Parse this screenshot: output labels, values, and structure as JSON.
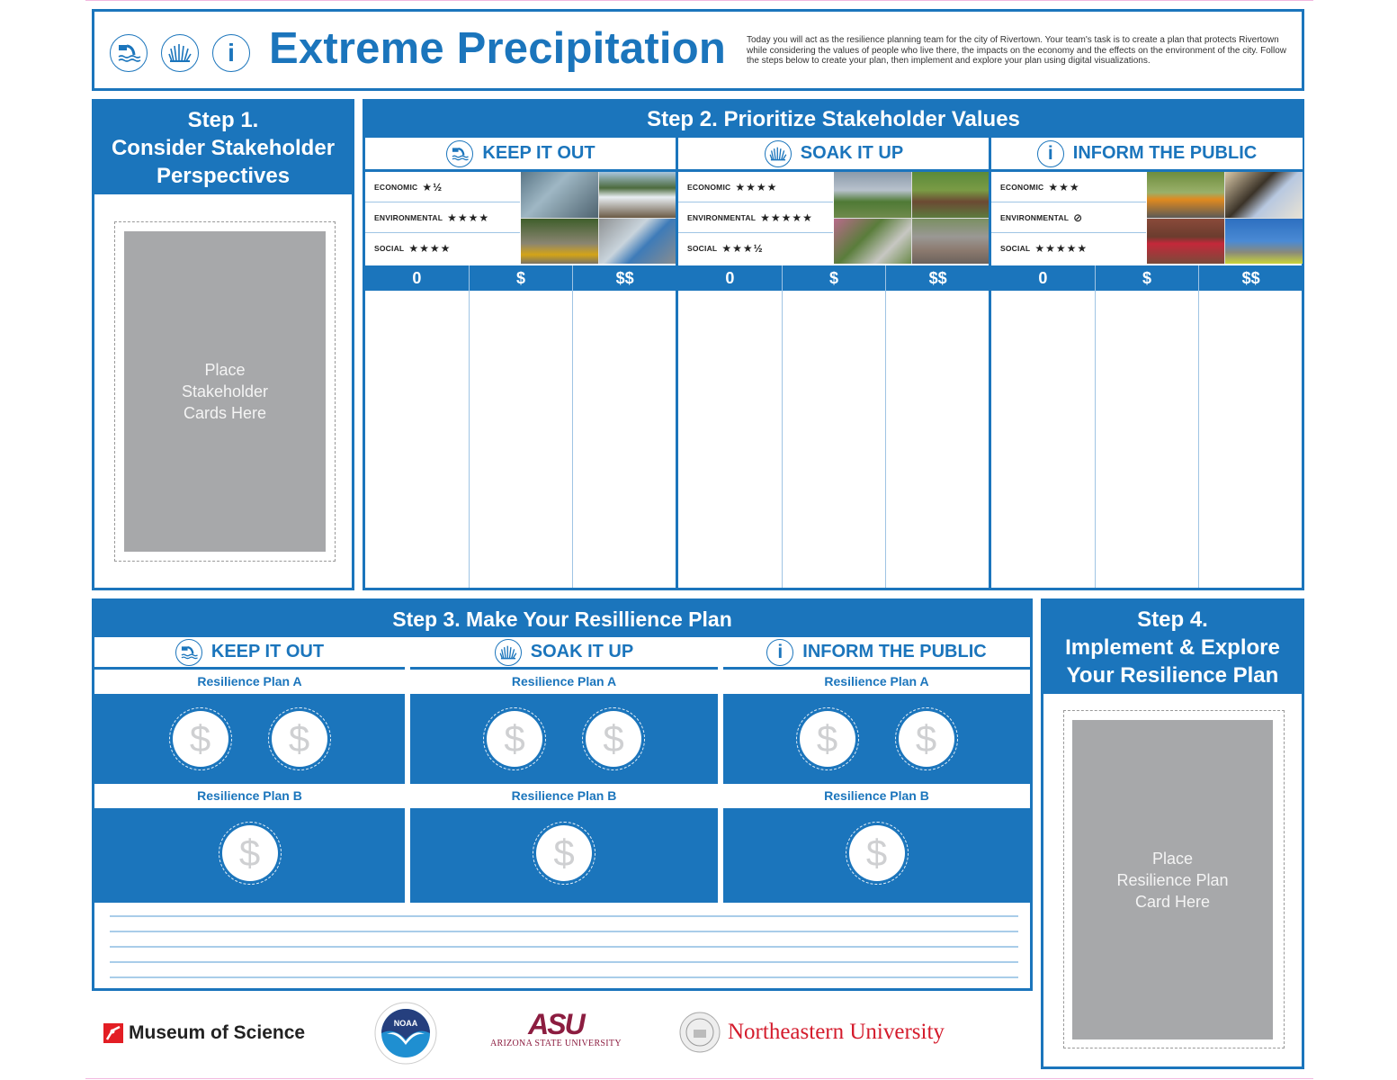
{
  "header": {
    "title": "Extreme Precipitation",
    "icons": [
      "pipe-outflow-icon",
      "grass-icon",
      "info-icon"
    ],
    "intro": "Today you will act as the resilience planning team for the city of Rivertown. Your team's task is to create a plan that protects Rivertown while considering the values of people who live there, the impacts on the economy and the effects on the environment of the city. Follow the steps below to create your plan, then implement and explore your plan using digital visualizations."
  },
  "colors": {
    "brand_blue": "#1b75bc",
    "placeholder_gray": "#a7a8aa",
    "msoi_red": "#e31e24",
    "asu_maroon": "#8c1d40",
    "asu_gold": "#ffc627",
    "northeastern_red": "#d41b2c"
  },
  "step1": {
    "title_line1": "Step 1.",
    "title_line2": "Consider Stakeholder",
    "title_line3": "Perspectives",
    "placeholder_line1": "Place",
    "placeholder_line2": "Stakeholder",
    "placeholder_line3": "Cards Here"
  },
  "step2": {
    "title": "Step 2. Prioritize Stakeholder Values",
    "cost_labels": [
      "0",
      "$",
      "$$"
    ],
    "strategies": [
      {
        "name": "KEEP IT OUT",
        "icon": "pipe-outflow-icon",
        "ratings": [
          {
            "label": "ECONOMIC",
            "stars": "★½",
            "value": 1.5
          },
          {
            "label": "ENVIRONMENTAL",
            "stars": "★★★★",
            "value": 4
          },
          {
            "label": "SOCIAL",
            "stars": "★★★★",
            "value": 4
          }
        ],
        "photos": [
          "water-treatment-tanks-photo",
          "dam-waterfall-photo",
          "construction-site-photo",
          "retention-basin-photo"
        ]
      },
      {
        "name": "SOAK IT UP",
        "icon": "grass-icon",
        "ratings": [
          {
            "label": "ECONOMIC",
            "stars": "★★★★",
            "value": 4
          },
          {
            "label": "ENVIRONMENTAL",
            "stars": "★★★★★",
            "value": 5
          },
          {
            "label": "SOCIAL",
            "stars": "★★★½",
            "value": 3.5
          }
        ],
        "photos": [
          "green-roof-photo",
          "wetland-park-photo",
          "rain-garden-photo",
          "permeable-pavement-photo"
        ]
      },
      {
        "name": "INFORM THE PUBLIC",
        "icon": "info-icon",
        "ratings": [
          {
            "label": "ECONOMIC",
            "stars": "★★★",
            "value": 3
          },
          {
            "label": "ENVIRONMENTAL",
            "stars": "⊘",
            "value": 0
          },
          {
            "label": "SOCIAL",
            "stars": "★★★★★",
            "value": 5
          }
        ],
        "photos": [
          "road-closure-photo",
          "community-volunteer-photo",
          "door-to-door-photo",
          "utility-worker-photo"
        ]
      }
    ]
  },
  "step3": {
    "title": "Step 3. Make Your Resillience Plan",
    "coin_symbol": "$",
    "columns": [
      {
        "name": "KEEP IT OUT",
        "icon": "pipe-outflow-icon",
        "plan_a": "Resilience Plan A",
        "plan_a_coins": 2,
        "plan_b": "Resilience Plan B",
        "plan_b_coins": 1
      },
      {
        "name": "SOAK IT UP",
        "icon": "grass-icon",
        "plan_a": "Resilience Plan A",
        "plan_a_coins": 2,
        "plan_b": "Resilience Plan B",
        "plan_b_coins": 1
      },
      {
        "name": "INFORM THE PUBLIC",
        "icon": "info-icon",
        "plan_a": "Resilience Plan A",
        "plan_a_coins": 2,
        "plan_b": "Resilience Plan B",
        "plan_b_coins": 1
      }
    ],
    "note_lines": 5
  },
  "step4": {
    "title_line1": "Step 4.",
    "title_line2": "Implement & Explore",
    "title_line3": "Your Resilience Plan",
    "placeholder_line1": "Place",
    "placeholder_line2": "Resilience Plan",
    "placeholder_line3": "Card Here"
  },
  "logos": {
    "museum": "Museum of Science",
    "noaa": "NOAA",
    "asu_mark": "ASU",
    "asu_name": "Arizona State University",
    "northeastern": "Northeastern University"
  }
}
